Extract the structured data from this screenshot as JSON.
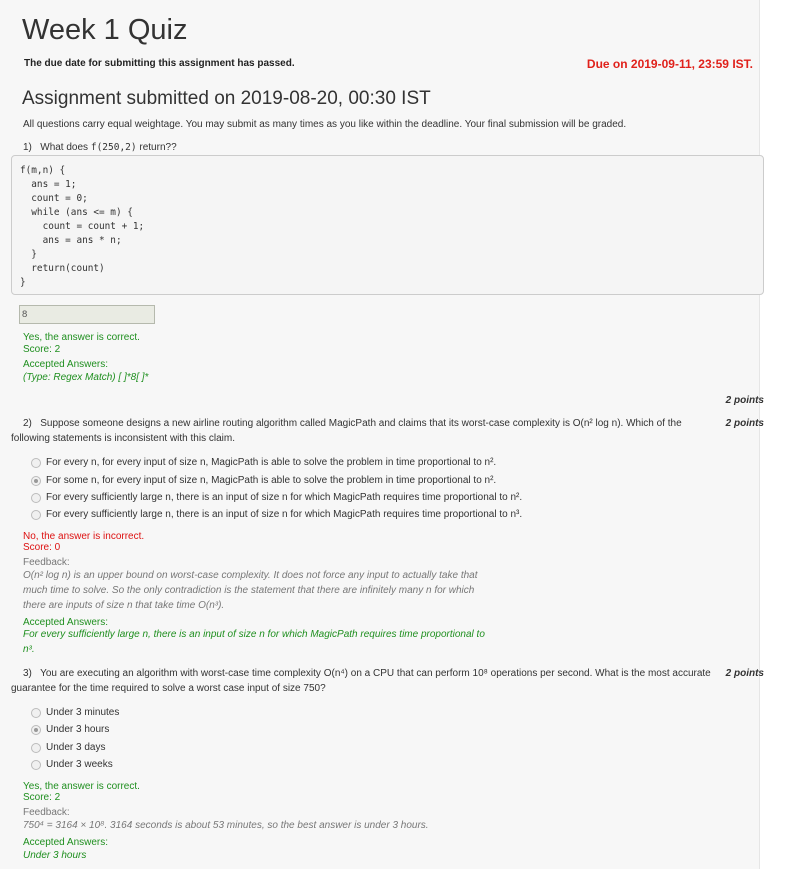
{
  "header": {
    "title": "Week 1 Quiz",
    "passed_notice": "The due date for submitting this assignment has passed.",
    "due": "Due on 2019-09-11, 23:59 IST.",
    "submitted": "Assignment submitted on 2019-08-20, 00:30 IST",
    "intro": "All questions carry equal weightage. You may submit as many times as you like within the deadline. Your final submission will be graded."
  },
  "q1": {
    "number": "1)",
    "prompt_pre": "What does",
    "prompt_code": "f(250,2)",
    "prompt_post": "return??",
    "code": "f(m,n) {\n  ans = 1;\n  count = 0;\n  while (ans <= m) {\n    count = count + 1;\n    ans = ans * n;\n  }\n  return(count)\n}",
    "answer_value": "8",
    "result": "Yes, the answer is correct.",
    "score": "Score: 2",
    "accepted_label": "Accepted Answers:",
    "accepted_value": "(Type: Regex Match) [ ]*8[ ]*",
    "points": "2 points"
  },
  "q2": {
    "number": "2)",
    "text_line1": "Suppose someone designs a new airline routing algorithm called MagicPath and claims that its worst-case complexity is O(n² log n). Which of the",
    "text_line2": "following statements is inconsistent with this claim.",
    "points": "2 points",
    "options": [
      "For every n, for every input of size n, MagicPath is able to solve the problem in time proportional to n².",
      "For some n, for every input of size n, MagicPath is able to solve the problem in time proportional to n².",
      "For every sufficiently large n, there is an input of size n for which MagicPath requires time proportional to n².",
      "For every sufficiently large n, there is an input of size n for which MagicPath requires time proportional to n³."
    ],
    "selected_index": 1,
    "result": "No, the answer is incorrect.",
    "score": "Score: 0",
    "feedback_label": "Feedback:",
    "feedback_lines": [
      "O(n² log n) is an upper bound on worst-case complexity. It does not force any input to actually take that",
      "much time to solve. So the only contradiction is the statement that there are infinitely many n for which",
      "there are inputs of size n that take time O(n³)."
    ],
    "accepted_label": "Accepted Answers:",
    "accepted_lines": [
      "For every sufficiently large n, there is an input of size n for which MagicPath requires time proportional to",
      "n³."
    ]
  },
  "q3": {
    "number": "3)",
    "text_line1": "You are executing an algorithm with worst-case time complexity O(n⁴) on a CPU that can perform 10⁸ operations per second. What is the most accurate",
    "text_line2": "guarantee for the time required to solve a worst case input of size 750?",
    "points": "2 points",
    "options": [
      "Under 3 minutes",
      "Under 3 hours",
      "Under 3 days",
      "Under 3 weeks"
    ],
    "selected_index": 1,
    "result": "Yes, the answer is correct.",
    "score": "Score: 2",
    "feedback_label": "Feedback:",
    "feedback_text": "750⁴ = 3164 × 10⁸. 3164 seconds is about 53 minutes, so the best answer is under 3 hours.",
    "accepted_label": "Accepted Answers:",
    "accepted_value": "Under 3 hours"
  },
  "colors": {
    "correct": "#1f8f1f",
    "incorrect": "#dd1111",
    "due": "#e0211b"
  }
}
